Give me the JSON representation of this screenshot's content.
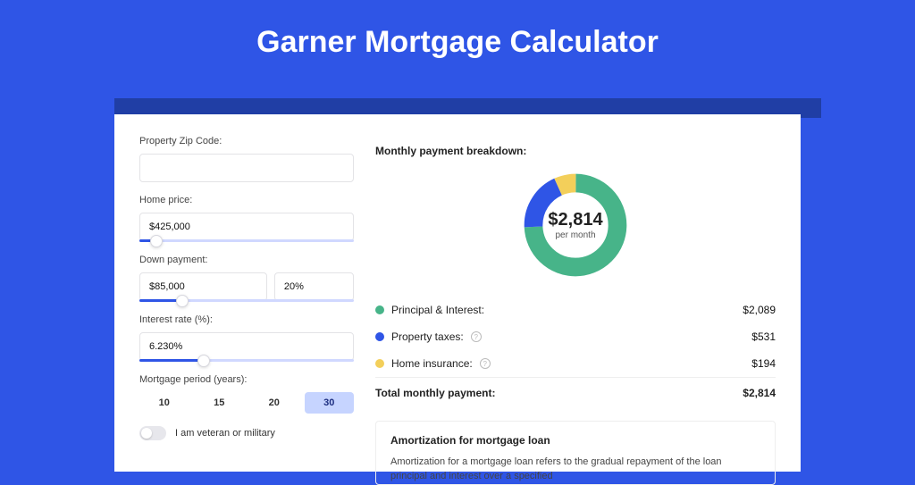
{
  "title": "Garner Mortgage Calculator",
  "form": {
    "zip": {
      "label": "Property Zip Code:",
      "value": ""
    },
    "price": {
      "label": "Home price:",
      "value": "$425,000",
      "slider_pct": 8
    },
    "down": {
      "label": "Down payment:",
      "amount": "$85,000",
      "pct": "20%",
      "slider_pct": 20
    },
    "rate": {
      "label": "Interest rate (%):",
      "value": "6.230%",
      "slider_pct": 30
    },
    "period": {
      "label": "Mortgage period (years):",
      "options": [
        "10",
        "15",
        "20",
        "30"
      ],
      "active": "30"
    },
    "veteran": {
      "label": "I am veteran or military",
      "on": false
    }
  },
  "breakdown": {
    "title": "Monthly payment breakdown:",
    "center_amount": "$2,814",
    "center_sub": "per month",
    "rows": [
      {
        "label": "Principal & Interest:",
        "amount": "$2,089",
        "color": "green",
        "info": false
      },
      {
        "label": "Property taxes:",
        "amount": "$531",
        "color": "blue",
        "info": true
      },
      {
        "label": "Home insurance:",
        "amount": "$194",
        "color": "yellow",
        "info": true
      }
    ],
    "total_label": "Total monthly payment:",
    "total_amount": "$2,814"
  },
  "amort": {
    "title": "Amortization for mortgage loan",
    "text": "Amortization for a mortgage loan refers to the gradual repayment of the loan principal and interest over a specified"
  },
  "chart_data": {
    "type": "pie",
    "title": "Monthly payment breakdown",
    "series": [
      {
        "name": "Principal & Interest",
        "value": 2089,
        "color": "#47b489"
      },
      {
        "name": "Property taxes",
        "value": 531,
        "color": "#2f55e6"
      },
      {
        "name": "Home insurance",
        "value": 194,
        "color": "#f3cf5a"
      }
    ],
    "total": 2814,
    "center_label": "$2,814 per month"
  }
}
